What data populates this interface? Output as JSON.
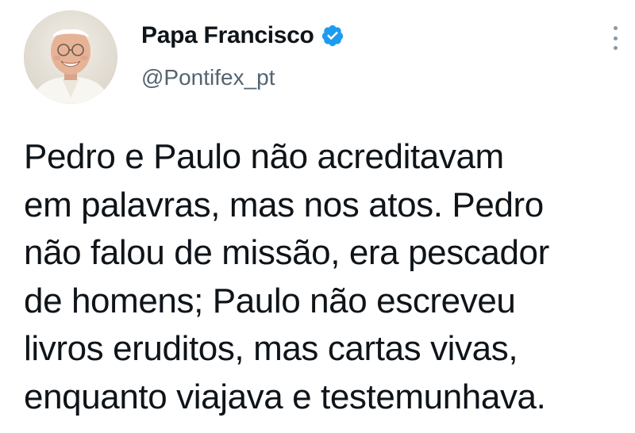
{
  "author": {
    "display_name": "Papa Francisco",
    "handle": "@Pontifex_pt",
    "verified": true,
    "avatar_icon": "avatar-photo",
    "verified_color": "#1d9bf0"
  },
  "menu": {
    "icon": "more-options-icon"
  },
  "tweet": {
    "lines": [
      "Pedro e Paulo não acreditavam",
      "em palavras, mas nos atos. Pedro",
      "não falou de missão, era pescador",
      "de homens; Paulo não escreveu",
      "livros eruditos, mas cartas vivas,",
      "enquanto viajava e testemunhava."
    ]
  }
}
